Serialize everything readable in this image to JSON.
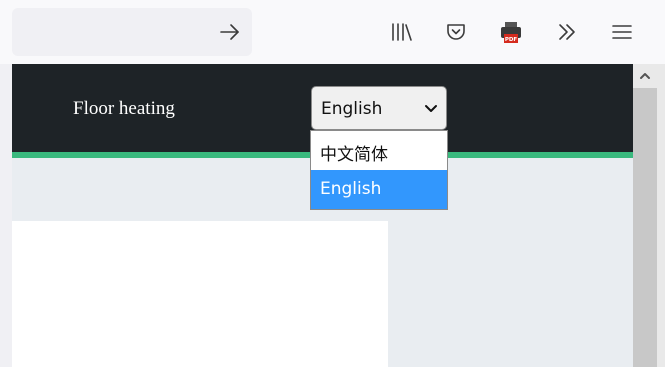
{
  "browser": {
    "icons": [
      "arrow-right-icon",
      "library-icon",
      "pocket-icon",
      "print-pdf-icon",
      "overflow-chevrons-icon",
      "hamburger-menu-icon"
    ],
    "pdf_badge": "PDF"
  },
  "site": {
    "brand": "Floor heating",
    "language_select": {
      "value": "English",
      "options": [
        "中文简体",
        "English"
      ],
      "selected_index": 1
    }
  },
  "colors": {
    "navbar": "#1e2327",
    "accent": "#3ab97e",
    "selected_option": "#3297fd"
  }
}
